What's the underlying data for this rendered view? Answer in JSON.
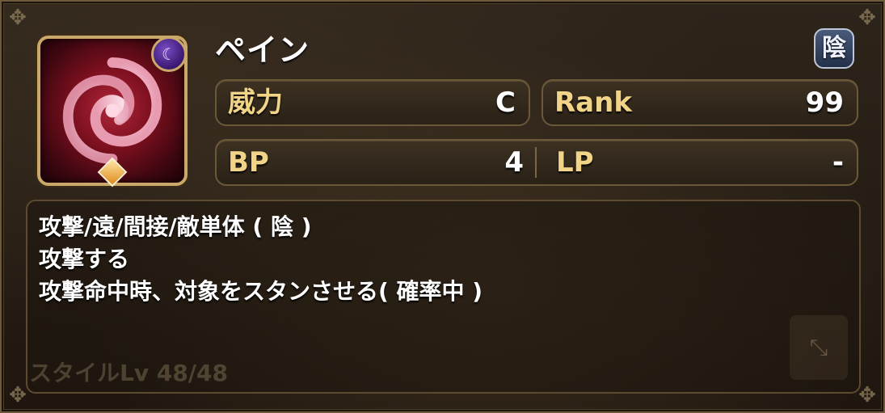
{
  "skill": {
    "name": "ペイン",
    "attribute_badge": "陰",
    "moon_icon": "moon-icon",
    "rarity_icon": "diamond-icon"
  },
  "stats": {
    "power": {
      "label": "威力",
      "value": "C"
    },
    "rank": {
      "label": "Rank",
      "value": "99"
    },
    "bp": {
      "label": "BP",
      "value": "4"
    },
    "lp": {
      "label": "LP",
      "value": "-"
    }
  },
  "description": {
    "lines": [
      "攻撃/遠/間接/敵単体 ( 陰 )",
      "攻撃する",
      "攻撃命中時、対象をスタンさせる( 確率中 )"
    ]
  },
  "background": {
    "ghost_text": "スタイルLv 48/48"
  },
  "colors": {
    "label_gold": "#f2d488",
    "frame_gold": "#c9a86a",
    "icon_red": "#7a0f1e"
  }
}
